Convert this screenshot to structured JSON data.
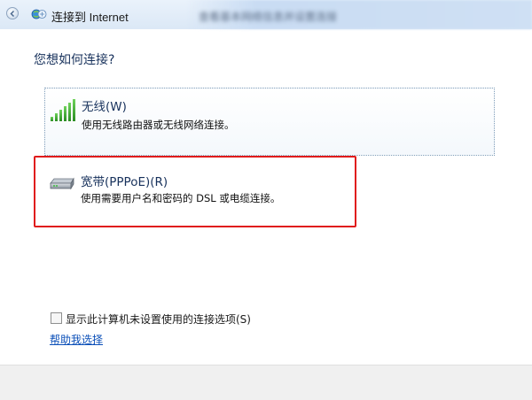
{
  "window": {
    "title": "连接到 Internet",
    "blurred_caption": "查看基本网络信息并设置连接"
  },
  "question": "您想如何连接?",
  "options": [
    {
      "title": "无线(W)",
      "description": "使用无线路由器或无线网络连接。",
      "icon": "wireless-signal-icon"
    },
    {
      "title": "宽带(PPPoE)(R)",
      "description": "使用需要用户名和密码的 DSL 或电缆连接。",
      "icon": "broadband-modem-icon"
    }
  ],
  "show_unconfigured": {
    "label": "显示此计算机未设置使用的连接选项(S)",
    "checked": false
  },
  "help_link": "帮助我选择",
  "colors": {
    "heading": "#18325c",
    "highlight_border": "#e01b1b",
    "link": "#0b4fb8",
    "signal_green": "#3aa82f"
  }
}
